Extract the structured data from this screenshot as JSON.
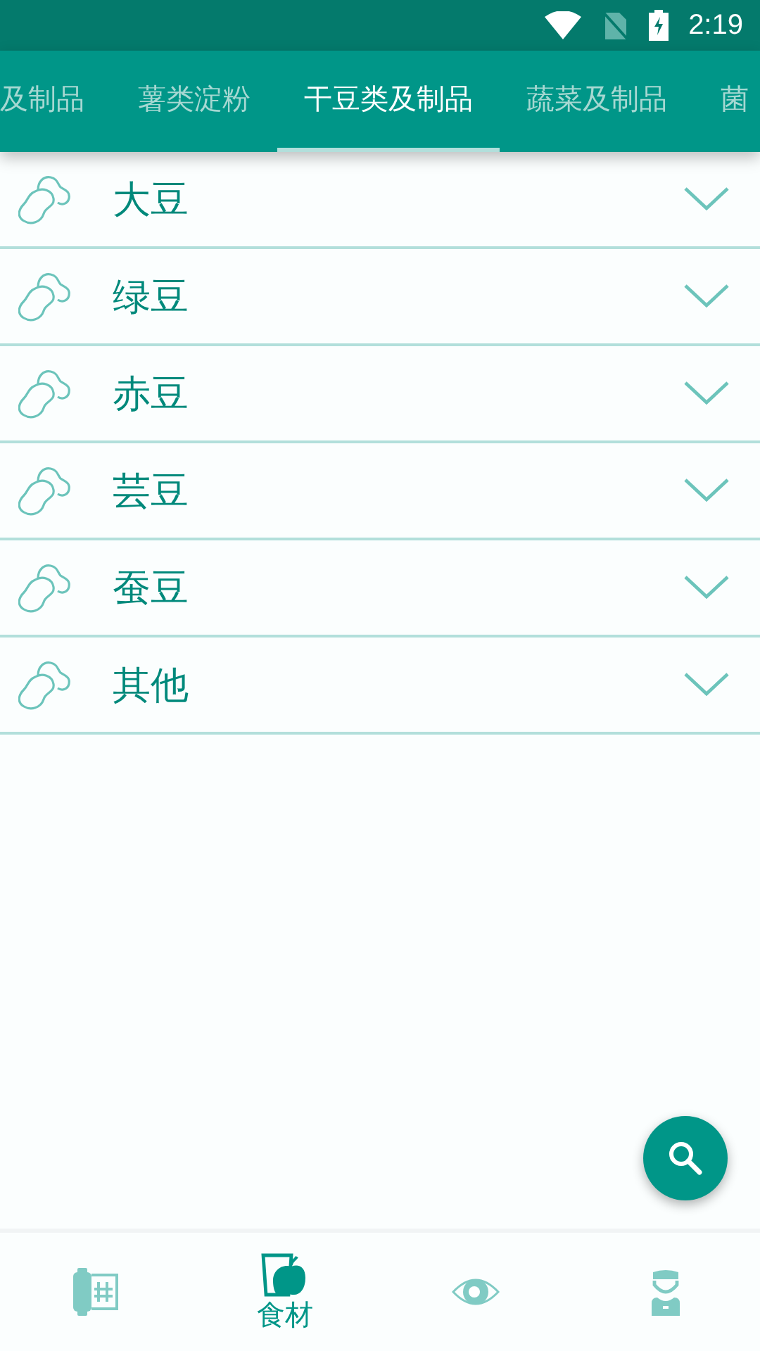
{
  "status_bar": {
    "time": "2:19"
  },
  "tabs": [
    {
      "label": "及制品",
      "selected": false
    },
    {
      "label": "薯类淀粉",
      "selected": false
    },
    {
      "label": "干豆类及制品",
      "selected": true
    },
    {
      "label": "蔬菜及制品",
      "selected": false
    },
    {
      "label": "菌",
      "selected": false
    }
  ],
  "items": [
    {
      "label": "大豆",
      "expanded": false
    },
    {
      "label": "绿豆",
      "expanded": false
    },
    {
      "label": "赤豆",
      "expanded": false
    },
    {
      "label": "芸豆",
      "expanded": false
    },
    {
      "label": "蚕豆",
      "expanded": false
    },
    {
      "label": "其他",
      "expanded": false
    }
  ],
  "bottom_nav": [
    {
      "kind": "film",
      "selected": false
    },
    {
      "kind": "food",
      "selected": true,
      "label": "食材"
    },
    {
      "kind": "eye",
      "selected": false
    },
    {
      "kind": "person",
      "selected": false
    }
  ]
}
